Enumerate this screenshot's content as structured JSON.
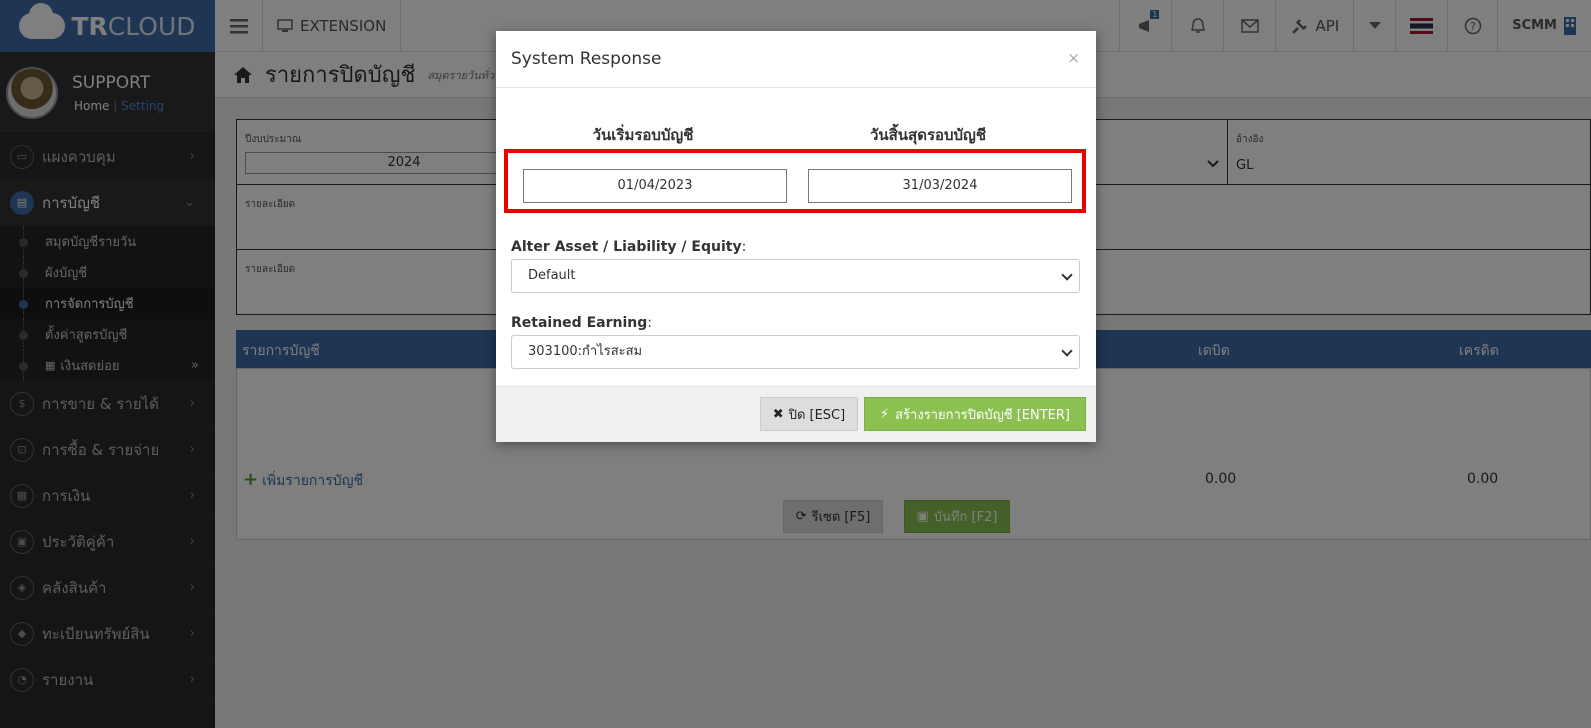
{
  "brand": {
    "logo_bold": "TR",
    "logo_light": "CLOUD"
  },
  "topbar": {
    "extension_label": "EXTENSION",
    "api_label": "API",
    "user_label": "SCMM",
    "badge": "1"
  },
  "profile": {
    "name": "SUPPORT",
    "home_link": "Home",
    "separator": "|",
    "setting_link": "Setting"
  },
  "sidebar": {
    "dashboard": "แผงควบคุม",
    "accounting": "การบัญชี",
    "sub": [
      "สมุดบัญชีรายวัน",
      "ผังบัญชี",
      "การจัดการบัญชี",
      "ตั้งค่าสูตรบัญชี",
      "เงินสดย่อย"
    ],
    "sales": "การขาย & รายได้",
    "purchases": "การซื้อ & รายจ่าย",
    "finance": "การเงิน",
    "partners": "ประวัติคู่ค้า",
    "inventory": "คลังสินค้า",
    "assets": "ทะเบียนทรัพย์สิน",
    "reports": "รายงาน"
  },
  "page": {
    "title": "รายการปิดบัญชี",
    "subtitle": "สมุดรายวันทั่ว",
    "fiscal_year_label": "ปีงบประมาณ",
    "fiscal_year_value": "2024",
    "reference_label": "อ้างอิง",
    "reference_value": "GL",
    "detail_label_1": "รายละเอียด",
    "detail_label_2": "รายละเอียด",
    "grid_col_account": "รายการบัญชี",
    "grid_col_debit": "เดบิต",
    "grid_col_credit": "เครดิต",
    "add_line": "เพิ่มรายการบัญชี",
    "total_debit": "0.00",
    "total_credit": "0.00",
    "reset_button": "รีเซต [F5]",
    "save_button": "บันทึก [F2]"
  },
  "modal": {
    "title": "System Response",
    "close_x": "×",
    "start_label": "วันเริ่มรอบบัญชี",
    "end_label": "วันสิ้นสุดรอบบัญชี",
    "start_date": "01/04/2023",
    "end_date": "31/03/2024",
    "alter_label": "Alter Asset / Liability / Equity",
    "alter_value": "Default",
    "retained_label": "Retained Earning",
    "retained_value": "303100:กำไรสะสม",
    "colon": ":",
    "close_button": "ปิด [ESC]",
    "create_button": "สร้างรายการปิดบัญชี [ENTER]"
  }
}
